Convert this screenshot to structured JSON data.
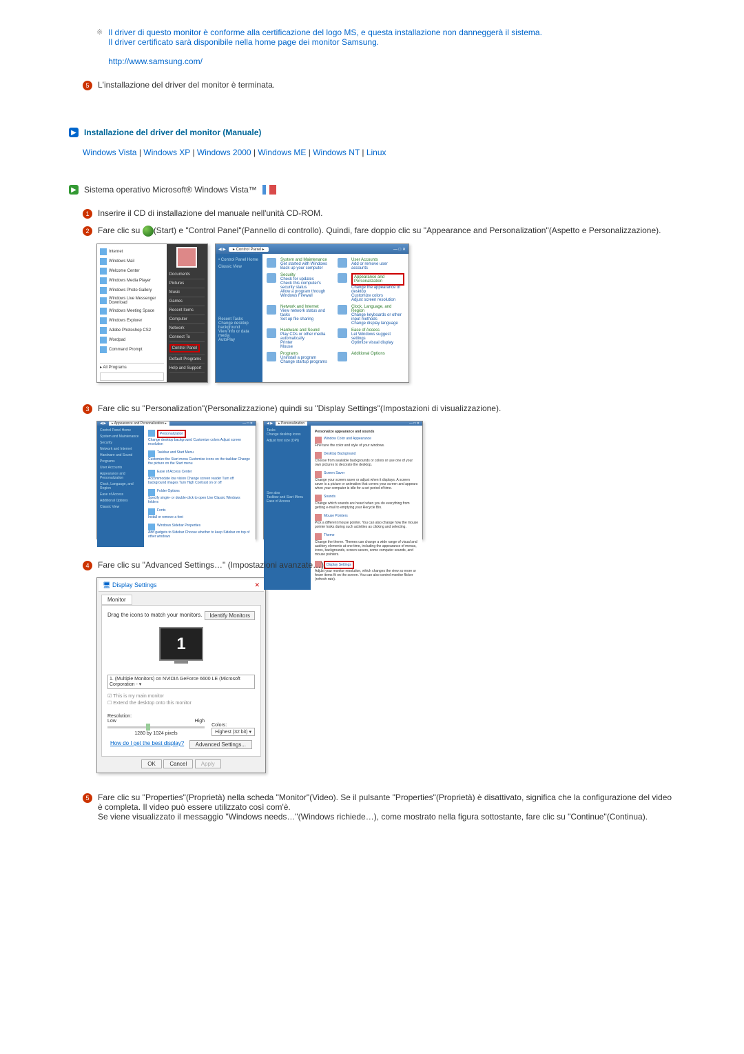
{
  "note": {
    "line1": "Il driver di questo monitor è conforme alla certificazione del logo MS, e questa installazione non danneggerà il sistema.",
    "line2": "Il driver certificato sarà disponibile nella home page dei monitor Samsung.",
    "url": "http://www.samsung.com/"
  },
  "step5_intro": "L'installazione del driver del monitor è terminata.",
  "heading": "Installazione del driver del monitor (Manuale)",
  "os_links": {
    "vista": "Windows Vista",
    "xp": "Windows XP",
    "w2000": "Windows 2000",
    "me": "Windows ME",
    "nt": "Windows NT",
    "linux": "Linux"
  },
  "os_heading": "Sistema operativo Microsoft® Windows Vista™",
  "steps": {
    "s1": "Inserire il CD di installazione del manuale nell'unità CD-ROM.",
    "s2a": "Fare clic su ",
    "s2b": "(Start) e \"Control Panel\"(Pannello di controllo). Quindi, fare doppio clic su \"Appearance and Personalization\"(Aspetto e Personalizzazione).",
    "s3": "Fare clic su \"Personalization\"(Personalizzazione) quindi su \"Display Settings\"(Impostazioni di visualizzazione).",
    "s4": "Fare clic su \"Advanced Settings…\" (Impostazioni avanzate…).",
    "s5": "Fare clic su \"Properties\"(Proprietà) nella scheda \"Monitor\"(Video). Se il pulsante \"Properties\"(Proprietà) è disattivato, significa che la configurazione del video è completa. Il video può essere utilizzato così com'è.",
    "s5b": "Se viene visualizzato il messaggio \"Windows needs…\"(Windows richiede…), come mostrato nella figura sottostante, fare clic su \"Continue\"(Continua)."
  },
  "start_menu": {
    "left": [
      "Internet",
      "Windows Mail",
      "Welcome Center",
      "Windows Media Player",
      "Windows Photo Gallery",
      "Windows Live Messenger Download",
      "Windows Meeting Space",
      "Windows Explorer",
      "Adobe Photoshop CS2",
      "Wordpad",
      "Command Prompt"
    ],
    "all_programs": "All Programs",
    "right": [
      "Documents",
      "Pictures",
      "Music",
      "Games",
      "Recent Items",
      "Computer",
      "Network",
      "Connect To",
      "Control Panel",
      "Default Programs",
      "Help and Support"
    ]
  },
  "control_panel": {
    "addr": "Control Panel",
    "side1": "Control Panel Home",
    "side2": "Classic View",
    "cats": [
      {
        "t": "System and Maintenance",
        "s": "Get started with Windows\nBack up your computer"
      },
      {
        "t": "User Accounts",
        "s": "Add or remove user accounts"
      },
      {
        "t": "Security",
        "s": "Check for updates\nCheck this computer's security status\nAllow a program through Windows Firewall"
      },
      {
        "t": "Appearance and Personalization",
        "s": "Change the appearance of desktop\nCustomize colors\nAdjust screen resolution",
        "hl": true
      },
      {
        "t": "Network and Internet",
        "s": "View network status and tasks\nSet up file sharing"
      },
      {
        "t": "Clock, Language, and Region",
        "s": "Change keyboards or other input methods\nChange display language"
      },
      {
        "t": "Hardware and Sound",
        "s": "Play CDs or other media automatically\nPrinter\nMouse"
      },
      {
        "t": "Ease of Access",
        "s": "Let Windows suggest settings\nOptimize visual display"
      },
      {
        "t": "Programs",
        "s": "Uninstall a program\nChange startup programs"
      },
      {
        "t": "Additional Options",
        "s": ""
      }
    ],
    "side_tasks_t": "Recent Tasks",
    "side_tasks": "Change desktop background\nView info or data media\nAutoPlay"
  },
  "app_pers": {
    "addr": "Appearance and Personalization",
    "side": [
      "Control Panel Home",
      "System and Maintenance",
      "Security",
      "Network and Internet",
      "Hardware and Sound",
      "Programs",
      "User Accounts",
      "Appearance and Personalization",
      "Clock, Language, and Region",
      "Ease of Access",
      "Additional Options",
      "Classic View"
    ],
    "items": [
      {
        "t": "Personalization",
        "s": "Change desktop background  Customize colors  Adjust screen resolution",
        "hl": true
      },
      {
        "t": "Taskbar and Start Menu",
        "s": "Customize the Start menu  Customize icons on the taskbar  Change the picture on the Start menu"
      },
      {
        "t": "Ease of Access Center",
        "s": "Accommodate low vision  Change screen reader  Turn off background images  Turn High Contrast on or off"
      },
      {
        "t": "Folder Options",
        "s": "Specify single- or double-click to open  Use Classic Windows folders"
      },
      {
        "t": "Fonts",
        "s": "Install or remove a font"
      },
      {
        "t": "Windows Sidebar Properties",
        "s": "Add gadgets to Sidebar  Choose whether to keep Sidebar on top of other windows"
      }
    ]
  },
  "pers_window": {
    "addr": "Personalization",
    "side_t": "Tasks",
    "side": [
      "Change desktop icons",
      "Adjust font size (DPI)"
    ],
    "heading": "Personalize appearance and sounds",
    "items": [
      {
        "t": "Window Color and Appearance",
        "s": "Fine tune the color and style of your windows."
      },
      {
        "t": "Desktop Background",
        "s": "Choose from available backgrounds or colors or use one of your own pictures to decorate the desktop."
      },
      {
        "t": "Screen Saver",
        "s": "Change your screen saver or adjust when it displays. A screen saver is a picture or animation that covers your screen and appears when your computer is idle for a set period of time."
      },
      {
        "t": "Sounds",
        "s": "Change which sounds are heard when you do everything from getting e-mail to emptying your Recycle Bin."
      },
      {
        "t": "Mouse Pointers",
        "s": "Pick a different mouse pointer. You can also change how the mouse pointer looks during such activities as clicking and selecting."
      },
      {
        "t": "Theme",
        "s": "Change the theme. Themes can change a wide range of visual and auditory elements at one time, including the appearance of menus, icons, backgrounds, screen savers, some computer sounds, and mouse pointers."
      },
      {
        "t": "Display Settings",
        "s": "Adjust your monitor resolution, which changes the view so more or fewer items fit on the screen. You can also control monitor flicker (refresh rate).",
        "hl": true
      }
    ],
    "see_also": "See also",
    "see_items": [
      "Taskbar and Start Menu",
      "Ease of Access"
    ]
  },
  "display_settings": {
    "title": "Display Settings",
    "tab": "Monitor",
    "drag": "Drag the icons to match your monitors.",
    "identify": "Identify Monitors",
    "mon_num": "1",
    "dropdown": "1. (Multiple Monitors) on NVIDIA GeForce 6600 LE (Microsoft Corporation - ▾",
    "chk1": "This is my main monitor",
    "chk2": "Extend the desktop onto this monitor",
    "res_label": "Resolution:",
    "low": "Low",
    "high": "High",
    "res_val": "1280 by 1024 pixels",
    "col_label": "Colors:",
    "col_val": "Highest (32 bit)   ▾",
    "help": "How do I get the best display?",
    "adv": "Advanced Settings...",
    "ok": "OK",
    "cancel": "Cancel",
    "apply": "Apply"
  }
}
